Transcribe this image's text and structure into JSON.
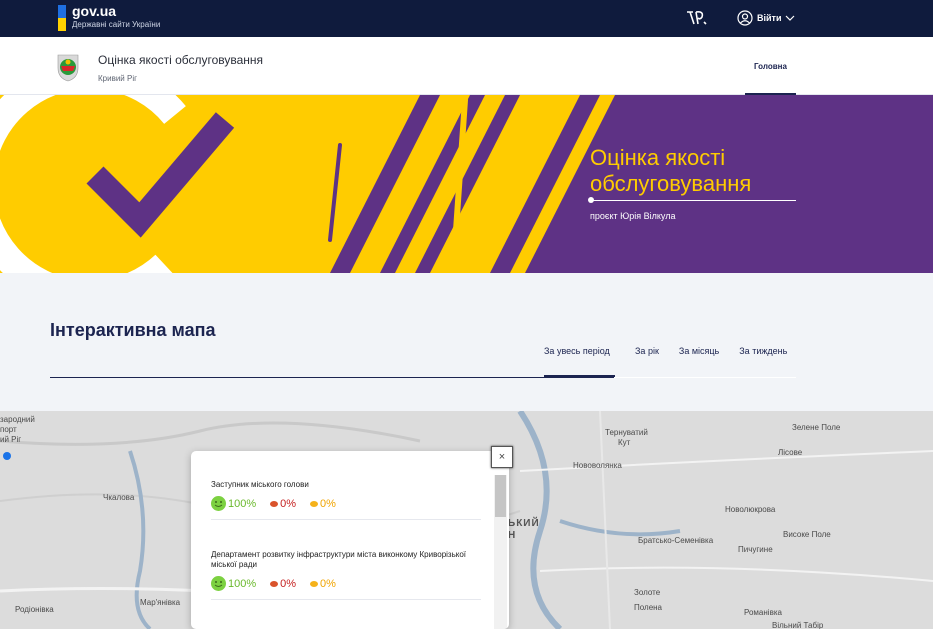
{
  "govbar": {
    "logo": "gov.ua",
    "subtitle": "Державні сайти України",
    "login_label": "Війти",
    "colors": {
      "background": "#0f1b3d",
      "flag_blue": "#1f6fe0",
      "flag_yellow": "#ffd200"
    }
  },
  "header": {
    "title": "Оцінка якості обслуговування",
    "city": "Кривий Ріг",
    "nav": [
      {
        "label": "Головна",
        "active": true
      }
    ]
  },
  "banner": {
    "title_line1": "Оцінка якості",
    "title_line2": "обслуговування",
    "subtitle": "проєкт Юрія Вілкула",
    "colors": {
      "yellow": "#ffcc00",
      "purple": "#5e3285"
    }
  },
  "section": {
    "title": "Інтерактивна мапа",
    "tabs": [
      {
        "label": "За увесь період",
        "active": true
      },
      {
        "label": "За рік",
        "active": false
      },
      {
        "label": "За місяць",
        "active": false
      },
      {
        "label": "За тиждень",
        "active": false
      }
    ]
  },
  "map": {
    "labels": [
      "зародний",
      "порт",
      "ий Ріг",
      "Тернуватий",
      "Кут",
      "Зелене Поле",
      "Лісове",
      "Нововолянка",
      "Чкалова",
      "Новолюкрова",
      "ЬКИЙ",
      "Н",
      "Братсько-Семенівка",
      "Високе Поле",
      "Пичугине",
      "Родіонівка",
      "Мар'янівка",
      "Золоте",
      "Полена",
      "Романівка",
      "Вільний Табір"
    ]
  },
  "popup": {
    "close_label": "×",
    "items": [
      {
        "name": "Заступник міського голови",
        "positive": "100%",
        "negative": "0%",
        "neutral": "0%"
      },
      {
        "name": "Департамент розвитку інфраструктури міста виконкому Криворізької міської ради",
        "positive": "100%",
        "negative": "0%",
        "neutral": "0%"
      }
    ]
  }
}
